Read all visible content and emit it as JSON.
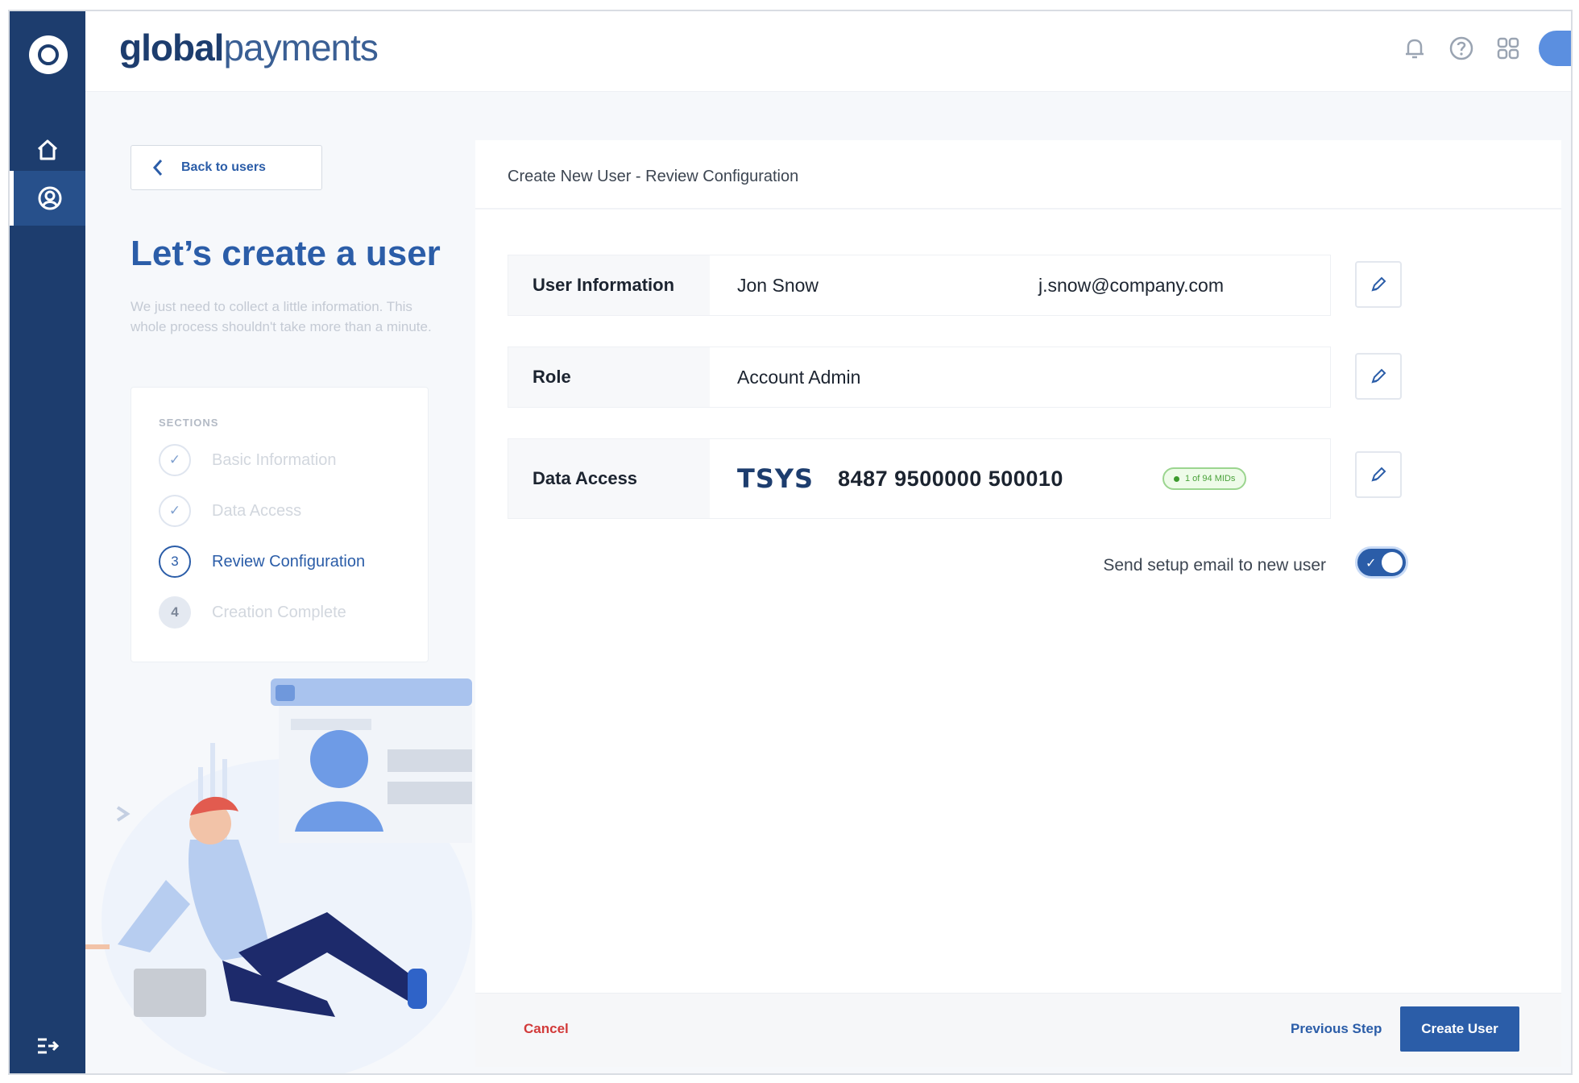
{
  "brand": {
    "bold": "global",
    "regular": "payments"
  },
  "rail": {
    "items": [
      {
        "name": "home",
        "icon": "home-icon"
      },
      {
        "name": "users",
        "icon": "user-circle-icon"
      }
    ]
  },
  "topbar": {
    "icons": [
      "bell-icon",
      "help-icon",
      "apps-grid-icon",
      "avatar"
    ]
  },
  "sidebar": {
    "back_label": "Back to users",
    "title": "Let’s create a user",
    "intro": "We just need to collect a little information. This whole process shouldn't take more than a minute.",
    "sections_title": "SECTIONS",
    "steps": [
      {
        "mark": "✓",
        "label": "Basic Information",
        "state": "done"
      },
      {
        "mark": "✓",
        "label": "Data Access",
        "state": "done"
      },
      {
        "mark": "3",
        "label": "Review Configuration",
        "state": "current"
      },
      {
        "mark": "4",
        "label": "Creation Complete",
        "state": "todo"
      }
    ]
  },
  "main": {
    "title": "Create New User - Review Configuration",
    "user_info": {
      "label": "User Information",
      "name": "Jon Snow",
      "email": "j.snow@company.com"
    },
    "role": {
      "label": "Role",
      "value": "Account Admin"
    },
    "data_access": {
      "label": "Data Access",
      "brand": "TSYS",
      "account": "8487 9500000 500010",
      "badge": "1 of 94 MIDs"
    },
    "send_email": {
      "label": "Send setup email to new user",
      "enabled": true
    }
  },
  "footer": {
    "cancel": "Cancel",
    "previous": "Previous Step",
    "create": "Create User"
  },
  "colors": {
    "rail": "#1d3d6e",
    "accent": "#2b5da8",
    "danger": "#d23a3a",
    "success": "#4aa23a"
  }
}
